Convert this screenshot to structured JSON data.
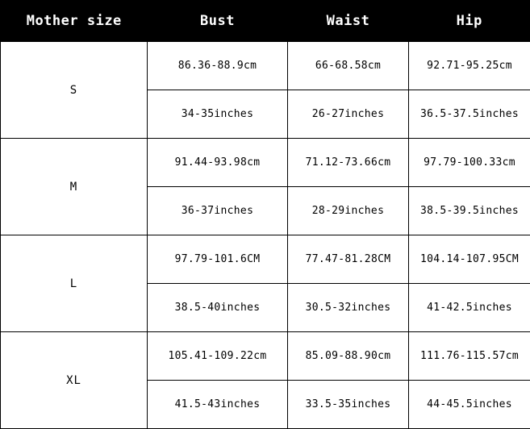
{
  "table": {
    "headers": [
      {
        "key": "size",
        "label": "Mother size"
      },
      {
        "key": "bust",
        "label": "Bust"
      },
      {
        "key": "waist",
        "label": "Waist"
      },
      {
        "key": "hip",
        "label": "Hip"
      }
    ],
    "colors": {
      "header_background": "#000000",
      "header_text": "#ffffff",
      "body_background": "#ffffff",
      "body_text": "#000000",
      "border": "#000000"
    },
    "rows": [
      {
        "size": "S",
        "cm": {
          "bust": "86.36-88.9cm",
          "waist": "66-68.58cm",
          "hip": "92.71-95.25cm"
        },
        "inches": {
          "bust": "34-35inches",
          "waist": "26-27inches",
          "hip": "36.5-37.5inches"
        }
      },
      {
        "size": "M",
        "cm": {
          "bust": "91.44-93.98cm",
          "waist": "71.12-73.66cm",
          "hip": "97.79-100.33cm"
        },
        "inches": {
          "bust": "36-37inches",
          "waist": "28-29inches",
          "hip": "38.5-39.5inches"
        }
      },
      {
        "size": "L",
        "cm": {
          "bust": "97.79-101.6CM",
          "waist": "77.47-81.28CM",
          "hip": "104.14-107.95CM"
        },
        "inches": {
          "bust": "38.5-40inches",
          "waist": "30.5-32inches",
          "hip": "41-42.5inches"
        }
      },
      {
        "size": "XL",
        "cm": {
          "bust": "105.41-109.22cm",
          "waist": "85.09-88.90cm",
          "hip": "111.76-115.57cm"
        },
        "inches": {
          "bust": "41.5-43inches",
          "waist": "33.5-35inches",
          "hip": "44-45.5inches"
        }
      }
    ]
  }
}
